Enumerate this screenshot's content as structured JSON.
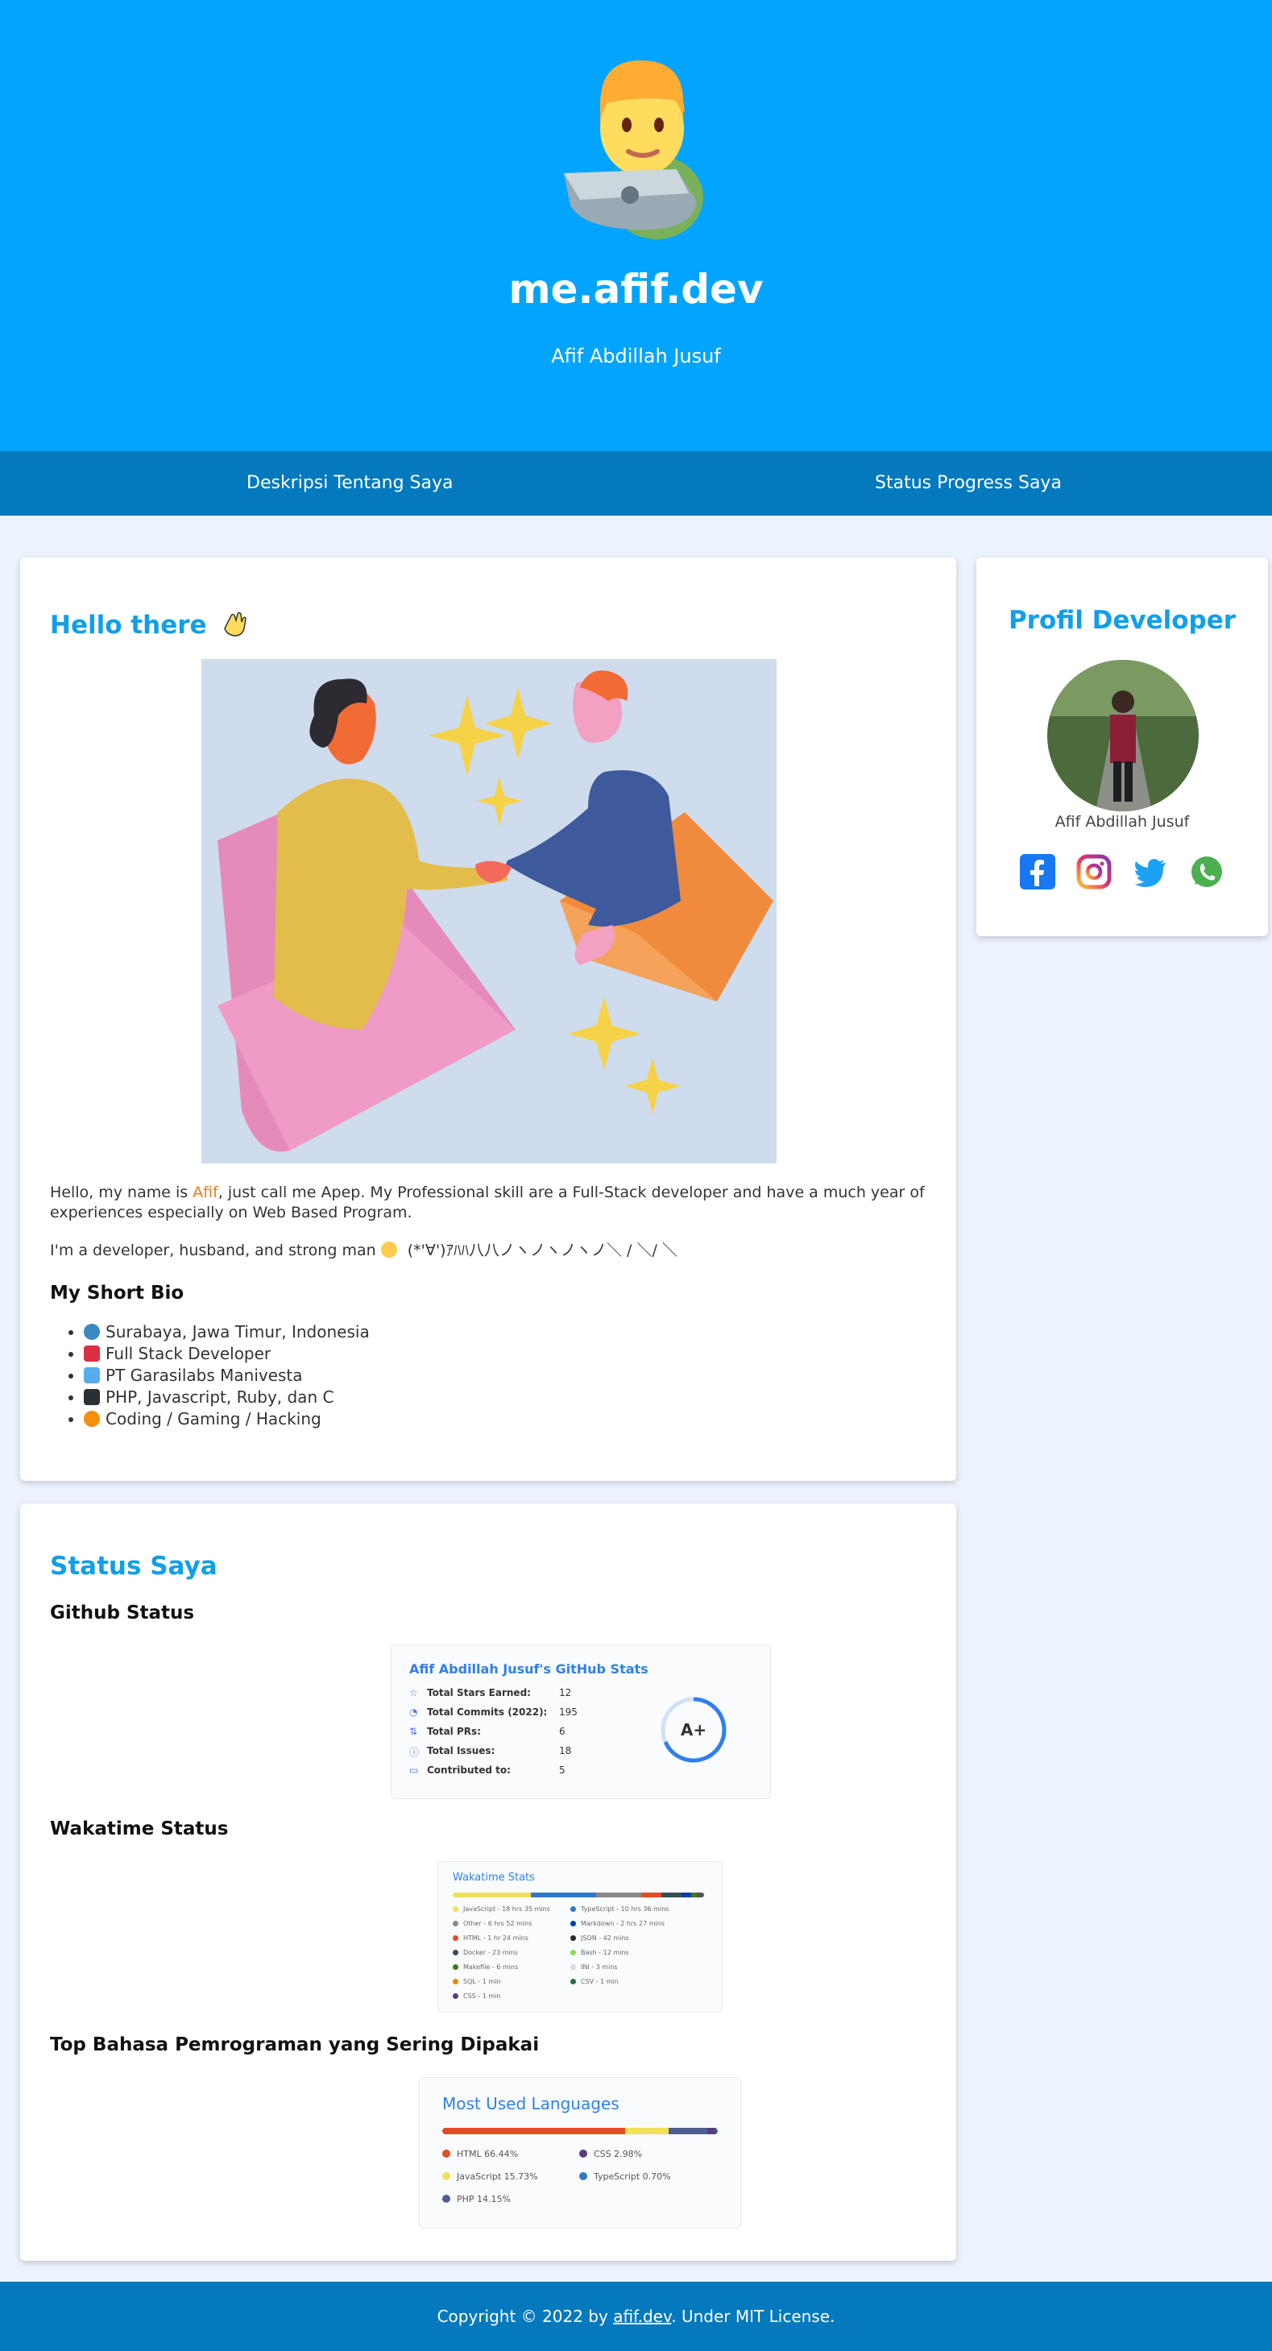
{
  "header": {
    "title": "me.afif.dev",
    "subtitle": "Afif Abdillah Jusuf",
    "logo_icon": "man-technologist-icon"
  },
  "nav": {
    "items": [
      {
        "label": "Deskripsi Tentang Saya"
      },
      {
        "label": "Status Progress Saya"
      }
    ]
  },
  "about": {
    "title": "Hello there",
    "title_icon": "waving-hand-icon",
    "illustration": "handshake-illustration",
    "intro_before": "Hello, my name is ",
    "intro_name": "Afif",
    "intro_after": ", just call me Apep. My Professional skill are a Full-Stack developer and have a much year of experiences especially on Web Based Program.",
    "tagline": "I'm a developer, husband, and strong man",
    "tagline_emoji": "grinning-face-icon",
    "tagline_kaomoji": " (*'∀')ｱﾊﾊ八八ノヽノヽノヽノ＼ / ＼/ ＼",
    "bio_title": "My Short Bio",
    "bio_items": [
      {
        "text": "Surabaya, Jawa Timur, Indonesia",
        "icon": "globe-icon"
      },
      {
        "text": "Full Stack Developer",
        "icon": "office-building-icon"
      },
      {
        "text": "PT Garasilabs Manivesta",
        "icon": "building-icon"
      },
      {
        "text": "PHP, Javascript, Ruby, dan C",
        "icon": "laptop-icon"
      },
      {
        "text": "Coding / Gaming / Hacking",
        "icon": "palette-icon"
      }
    ]
  },
  "profile": {
    "title": "Profil Developer",
    "name": "Afif Abdillah Jusuf",
    "avatar": "avatar",
    "social": [
      {
        "name": "facebook",
        "icon": "facebook-icon",
        "color": "#1877f2"
      },
      {
        "name": "instagram",
        "icon": "instagram-icon",
        "color": "#d6249f"
      },
      {
        "name": "twitter",
        "icon": "twitter-icon",
        "color": "#1da1f2"
      },
      {
        "name": "whatsapp",
        "icon": "whatsapp-icon",
        "color": "#4caf50"
      }
    ]
  },
  "status": {
    "title": "Status Saya",
    "github_title": "Github Status",
    "github_card": {
      "title": "Afif Abdillah Jusuf's GitHub Stats",
      "rows": [
        {
          "label": "Total Stars Earned:",
          "value": "12",
          "icon": "star-icon"
        },
        {
          "label": "Total Commits (2022):",
          "value": "195",
          "icon": "history-icon"
        },
        {
          "label": "Total PRs:",
          "value": "6",
          "icon": "pull-request-icon"
        },
        {
          "label": "Total Issues:",
          "value": "18",
          "icon": "issue-icon"
        },
        {
          "label": "Contributed to:",
          "value": "5",
          "icon": "repo-icon"
        }
      ],
      "grade": "A+"
    },
    "wakatime_title": "Wakatime Status",
    "wakatime_card": {
      "title": "Wakatime Stats",
      "bar": [
        {
          "color": "#f1e05a",
          "fraction": 0.31
        },
        {
          "color": "#3178c6",
          "fraction": 0.26
        },
        {
          "color": "#8a8a8a",
          "fraction": 0.18
        },
        {
          "color": "#e34c26",
          "fraction": 0.08
        },
        {
          "color": "#384d54",
          "fraction": 0.08
        },
        {
          "color": "#083fa1",
          "fraction": 0.04
        },
        {
          "color": "#427819",
          "fraction": 0.02
        },
        {
          "color": "#555555",
          "fraction": 0.03
        }
      ],
      "left": [
        {
          "text": "JavaScript - 18 hrs 35 mins",
          "color": "#f1e05a"
        },
        {
          "text": "Other - 6 hrs 52 mins",
          "color": "#8a8a8a"
        },
        {
          "text": "HTML - 1 hr 24 mins",
          "color": "#e34c26"
        },
        {
          "text": "Docker - 23 mins",
          "color": "#384d54"
        },
        {
          "text": "Makefile - 6 mins",
          "color": "#427819"
        },
        {
          "text": "SQL - 1 min",
          "color": "#e38c00"
        },
        {
          "text": "CSS - 1 min",
          "color": "#563d7c"
        }
      ],
      "right": [
        {
          "text": "TypeScript - 10 hrs 36 mins",
          "color": "#3178c6"
        },
        {
          "text": "Markdown - 2 hrs 27 mins",
          "color": "#083fa1"
        },
        {
          "text": "JSON - 42 mins",
          "color": "#292929"
        },
        {
          "text": "Bash - 12 mins",
          "color": "#89e051"
        },
        {
          "text": "INI - 3 mins",
          "color": "#d1dbe0"
        },
        {
          "text": "CSV - 1 min",
          "color": "#237346"
        }
      ]
    },
    "languages_title": "Top Bahasa Pemrograman yang Sering Dipakai",
    "languages_card": {
      "title": "Most Used Languages",
      "langs": [
        {
          "name": "HTML 66.44%",
          "color": "#e34c26",
          "pct": 66.44
        },
        {
          "name": "JavaScript 15.73%",
          "color": "#f1e05a",
          "pct": 15.73
        },
        {
          "name": "PHP 14.15%",
          "color": "#4f5d95",
          "pct": 14.15
        },
        {
          "name": "CSS 2.98%",
          "color": "#563d7c",
          "pct": 2.98
        },
        {
          "name": "TypeScript 0.70%",
          "color": "#3178c6",
          "pct": 0.7
        }
      ]
    }
  },
  "footer": {
    "before": "Copyright © 2022 by ",
    "link": "afif.dev",
    "after": ". Under MIT License."
  }
}
